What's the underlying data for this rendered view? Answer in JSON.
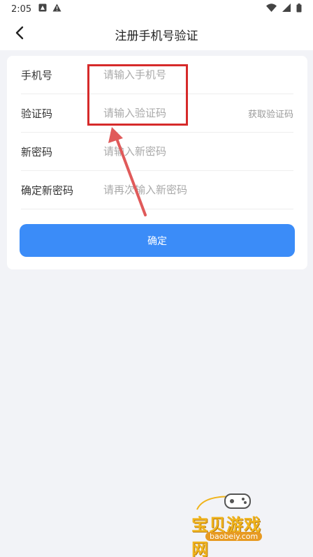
{
  "status_bar": {
    "time": "2:05",
    "icons_left": [
      "app-notification-icon",
      "warning-icon"
    ],
    "icons_right": [
      "wifi-icon",
      "signal-icon",
      "battery-icon"
    ]
  },
  "nav": {
    "back_icon": "chevron-left-icon",
    "title": "注册手机号验证"
  },
  "form": {
    "phone": {
      "label": "手机号",
      "placeholder": "请输入手机号"
    },
    "code": {
      "label": "验证码",
      "placeholder": "请输入验证码",
      "action": "获取验证码"
    },
    "new_password": {
      "label": "新密码",
      "placeholder": "请输入新密码"
    },
    "confirm_password": {
      "label": "确定新密码",
      "placeholder": "请再次输入新密码"
    },
    "submit_label": "确定"
  },
  "annotation": {
    "box_color": "#d62a2a",
    "arrow_color": "#e05a5a"
  },
  "watermark": {
    "text": "宝贝游戏网",
    "url": "baobeiy.com"
  },
  "colors": {
    "primary": "#3b8cf8",
    "background": "#f2f3f7"
  }
}
